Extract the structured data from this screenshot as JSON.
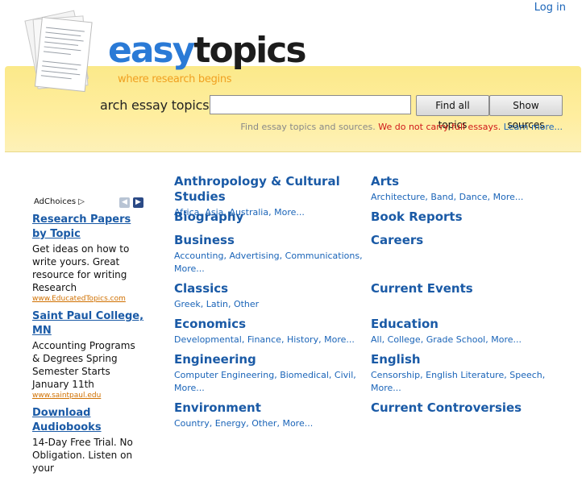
{
  "header": {
    "login_label": "Log in",
    "logo_easy": "easy",
    "logo_topics": "topics",
    "tagline": "where research begins"
  },
  "search": {
    "label": "arch essay topics:",
    "input_value": "",
    "find_all_label": "Find all topics",
    "show_sources_label": "Show sources",
    "note_text": "Find essay topics and sources.",
    "note_warning": "We do not carry full essays.",
    "note_link": "Learn more..."
  },
  "ads": {
    "adchoices_label": "AdChoices",
    "items": [
      {
        "title": "Research Papers by Topic",
        "body": "Get ideas on how to write yours. Great resource for writing Research",
        "url": "www.EducatedTopics.com"
      },
      {
        "title": "Saint Paul College, MN",
        "body": "Accounting Programs & Degrees Spring Semester Starts January 11th",
        "url": "www.saintpaul.edu"
      },
      {
        "title": "Download Audiobooks",
        "body": "14-Day Free Trial. No Obligation. Listen on your",
        "url": ""
      }
    ]
  },
  "topics": [
    {
      "title": "Anthropology & Cultural Studies",
      "subs": [
        "Africa",
        "Asia",
        "Australia",
        "More..."
      ]
    },
    {
      "title": "Arts",
      "subs": [
        "Architecture",
        "Band",
        "Dance",
        "More..."
      ]
    },
    {
      "title": "Biography",
      "subs": []
    },
    {
      "title": "Book Reports",
      "subs": []
    },
    {
      "title": "Business",
      "subs": [
        "Accounting",
        "Advertising",
        "Communications",
        "More..."
      ]
    },
    {
      "title": "Careers",
      "subs": []
    },
    {
      "title": "Classics",
      "subs": [
        "Greek",
        "Latin",
        "Other"
      ]
    },
    {
      "title": "Current Events",
      "subs": []
    },
    {
      "title": "Economics",
      "subs": [
        "Developmental",
        "Finance",
        "History",
        "More..."
      ]
    },
    {
      "title": "Education",
      "subs": [
        "All",
        "College",
        "Grade School",
        "More..."
      ]
    },
    {
      "title": "Engineering",
      "subs": [
        "Computer Engineering",
        "Biomedical",
        "Civil",
        "More..."
      ]
    },
    {
      "title": "English",
      "subs": [
        "Censorship",
        "English Literature",
        "Speech",
        "More..."
      ]
    },
    {
      "title": "Environment",
      "subs": [
        "Country",
        "Energy",
        "Other",
        "More..."
      ]
    },
    {
      "title": "Current Controversies",
      "subs": []
    }
  ],
  "colors": {
    "band": "#ffeea0",
    "link": "#1a5aa6",
    "warning": "#d01818",
    "ad_url": "#d07000",
    "accent_orange": "#f0a020"
  }
}
